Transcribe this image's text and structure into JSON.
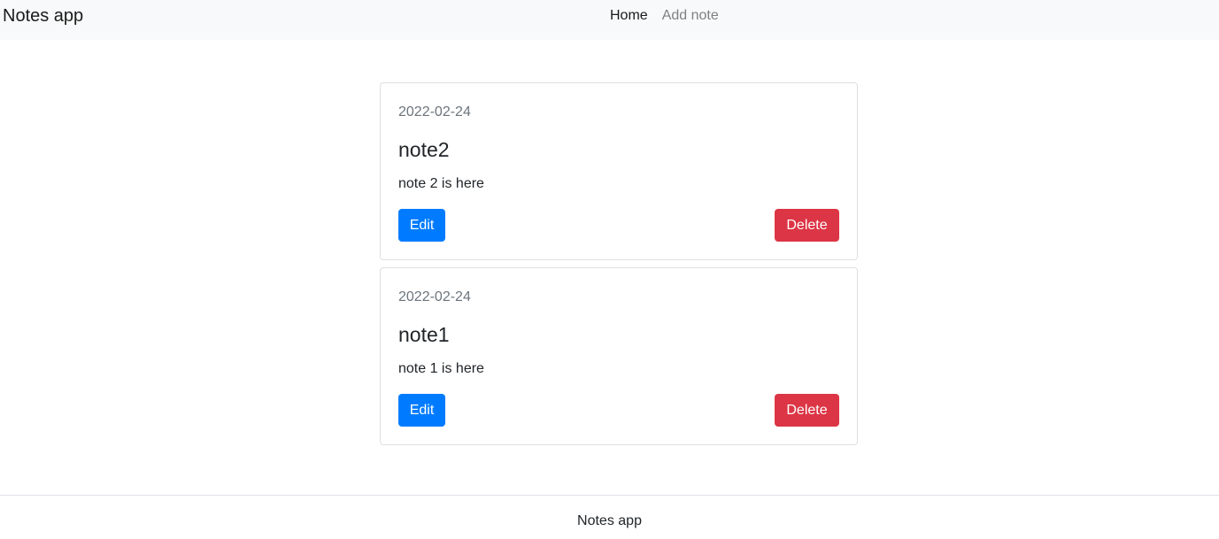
{
  "navbar": {
    "brand": "Notes app",
    "links": [
      {
        "label": "Home",
        "active": true
      },
      {
        "label": "Add note",
        "active": false
      }
    ]
  },
  "notes": [
    {
      "date": "2022-02-24",
      "title": "note2",
      "text": "note 2 is here",
      "edit_label": "Edit",
      "delete_label": "Delete"
    },
    {
      "date": "2022-02-24",
      "title": "note1",
      "text": "note 1 is here",
      "edit_label": "Edit",
      "delete_label": "Delete"
    }
  ],
  "footer": {
    "text": "Notes app"
  },
  "colors": {
    "navbar_bg": "#f8f9fa",
    "edit_button": "#007bff",
    "delete_button": "#dc3545",
    "muted_text": "#6c757d"
  }
}
